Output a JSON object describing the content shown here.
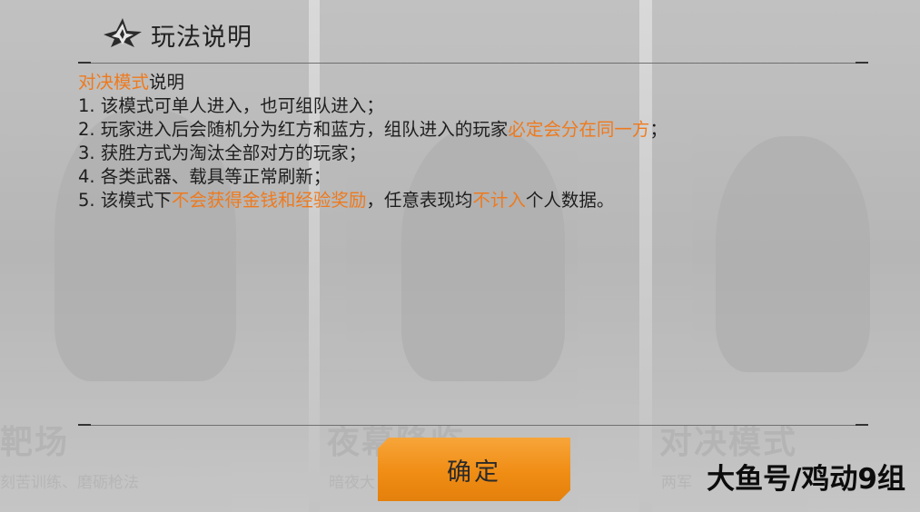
{
  "dialog": {
    "title": "玩法说明",
    "heading": {
      "highlight": "对决模式",
      "text": "说明"
    },
    "rules": [
      [
        {
          "text": "1. 该模式可单人进入，也可组队进入；"
        }
      ],
      [
        {
          "text": "2. 玩家进入后会随机分为红方和蓝方，组队进入的玩家"
        },
        {
          "text": "必定会分在同一方",
          "hl": true
        },
        {
          "text": "；"
        }
      ],
      [
        {
          "text": "3. 获胜方式为淘汰全部对方的玩家；"
        }
      ],
      [
        {
          "text": "4. 各类武器、载具等正常刷新；"
        }
      ],
      [
        {
          "text": "5. 该模式下"
        },
        {
          "text": "不会获得金钱和经验奖励",
          "hl": true
        },
        {
          "text": "，任意表现均"
        },
        {
          "text": "不计入",
          "hl": true
        },
        {
          "text": "个人数据。"
        }
      ]
    ],
    "confirm_label": "确定"
  },
  "background_cards": [
    {
      "title": "靶场",
      "subtitle": "刻苦训练、磨砺枪法"
    },
    {
      "title": "夜幕降临",
      "subtitle": "暗夜大"
    },
    {
      "title": "对决模式",
      "subtitle": "两军"
    }
  ],
  "watermark": "大鱼号/鸡动9组",
  "colors": {
    "highlight": "#ee7a1e",
    "button": "#f08d14",
    "text": "#1e1e1e"
  }
}
